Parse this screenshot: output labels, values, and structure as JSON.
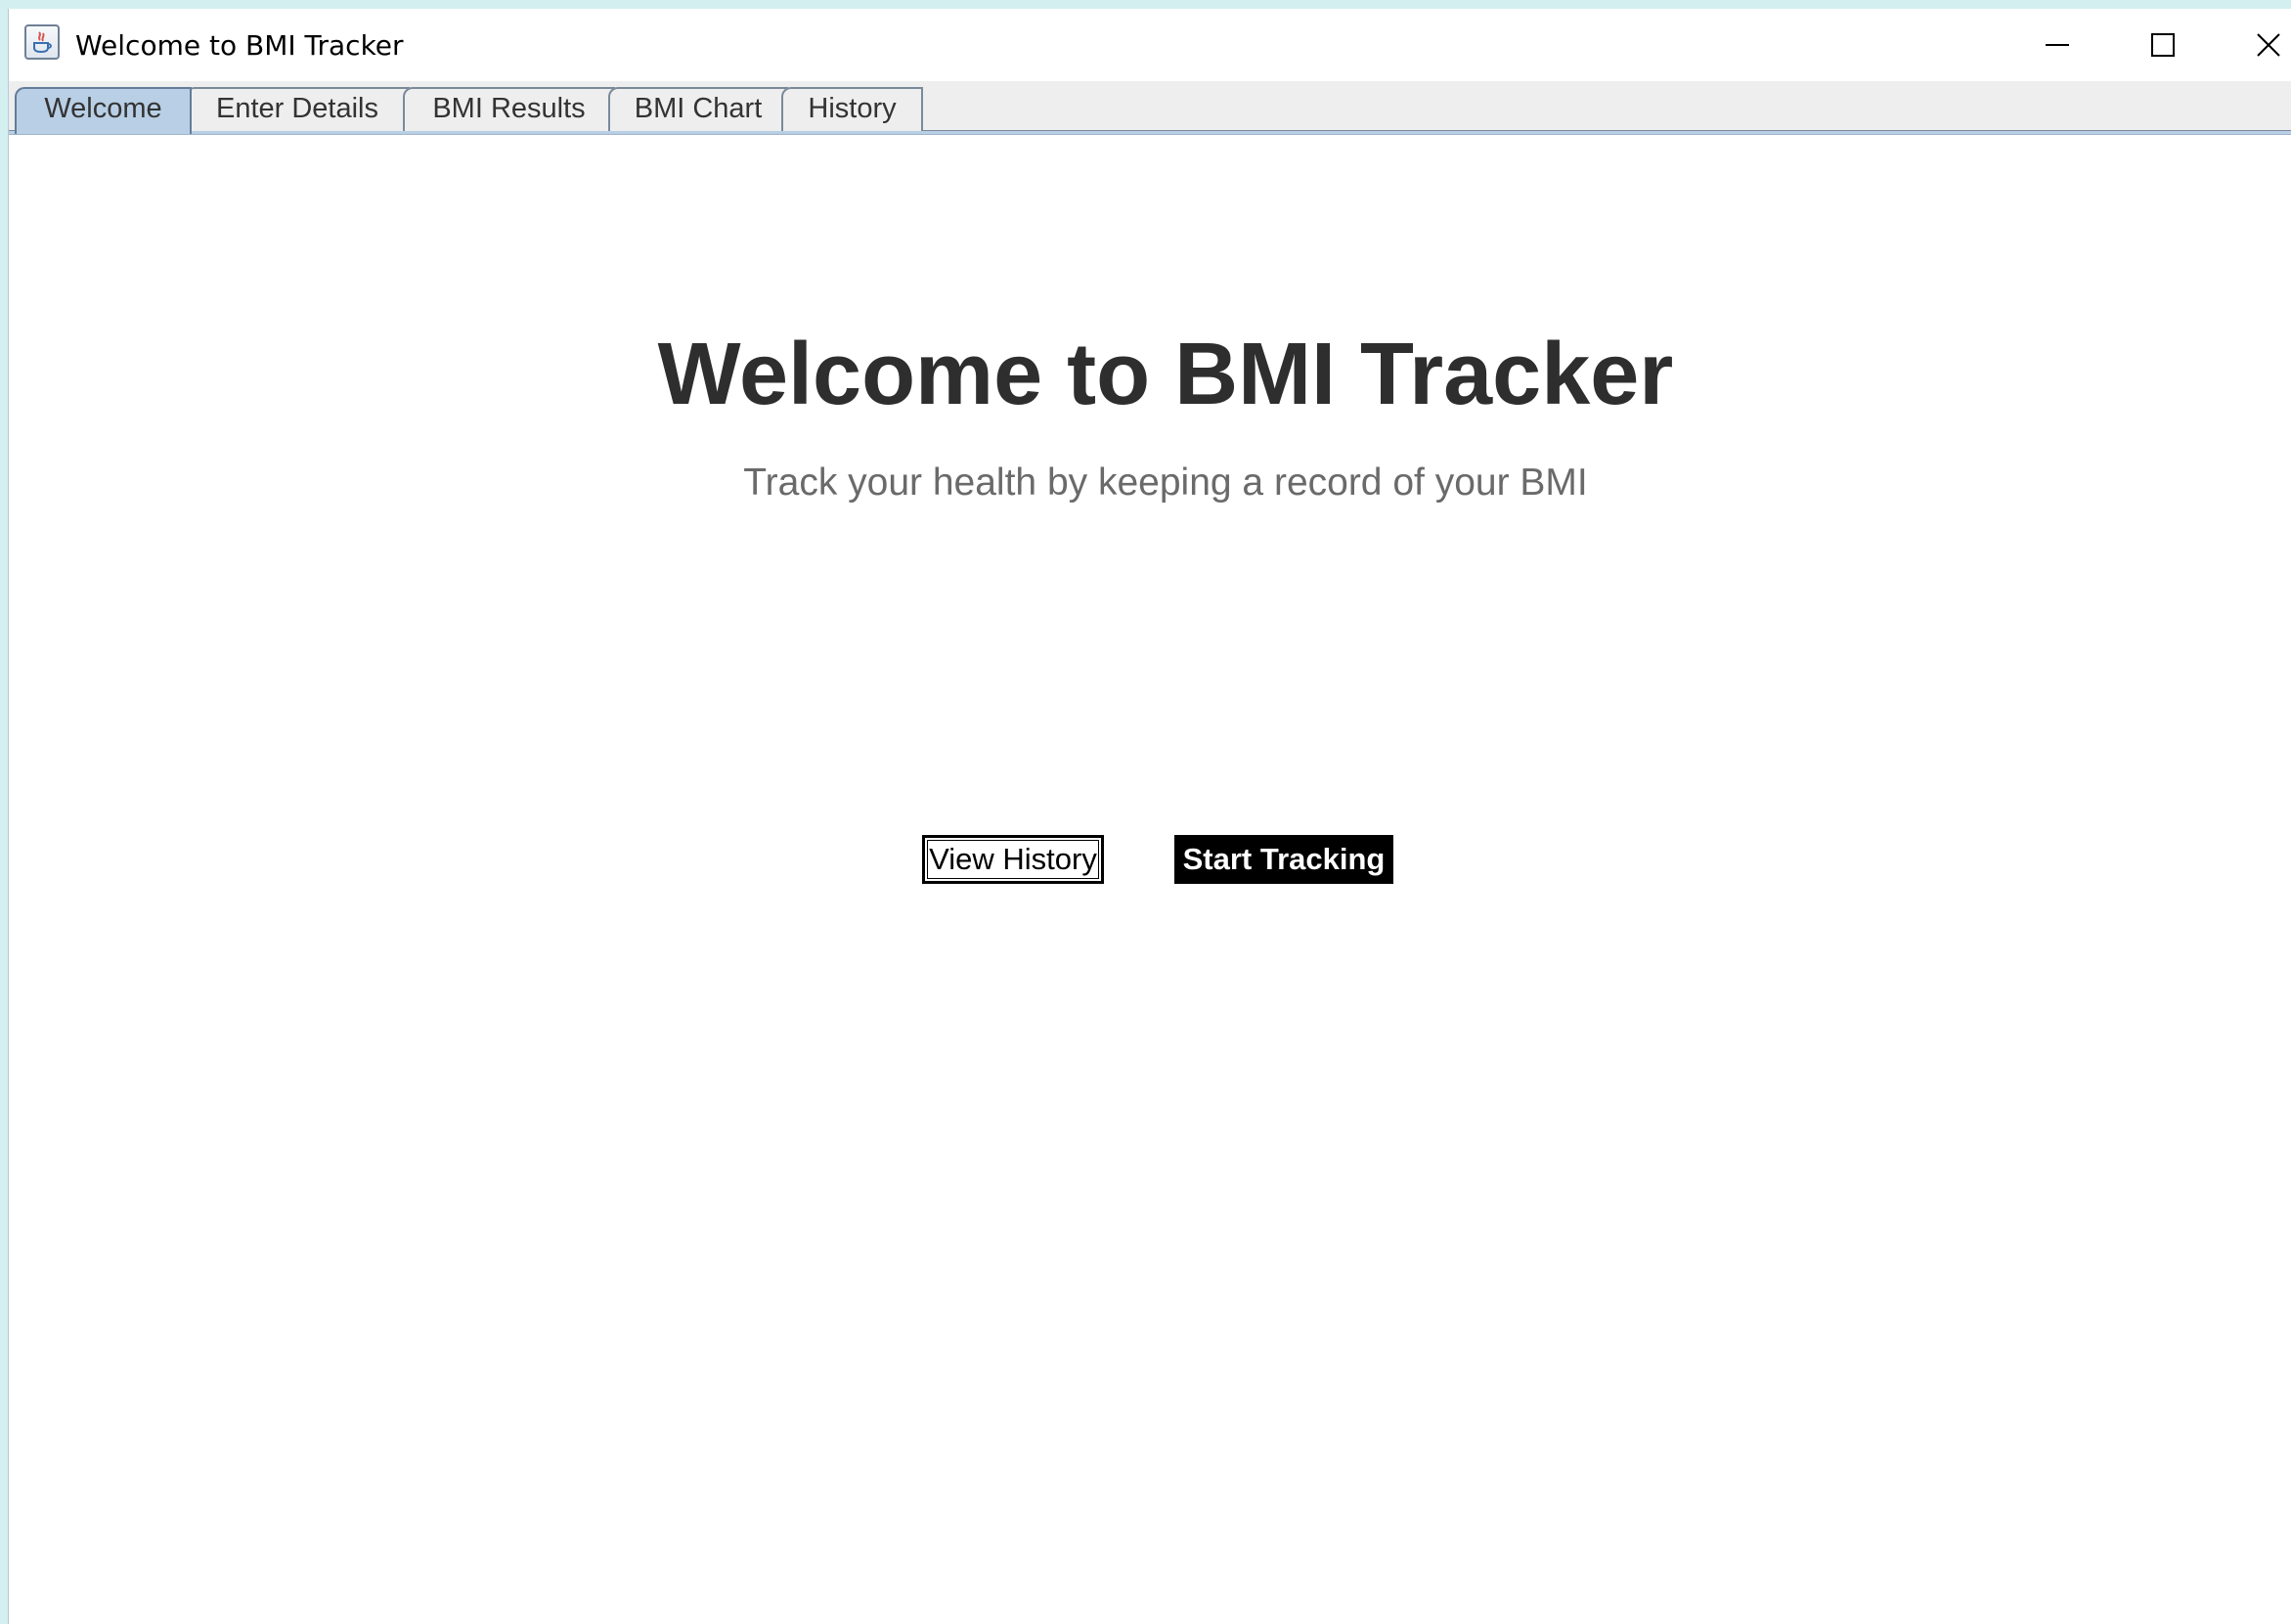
{
  "window": {
    "title": "Welcome to BMI Tracker",
    "controls": {
      "minimize": "minimize-icon",
      "maximize": "maximize-icon",
      "close": "close-icon"
    }
  },
  "tabs": [
    {
      "label": "Welcome",
      "selected": true
    },
    {
      "label": "Enter Details",
      "selected": false
    },
    {
      "label": "BMI Results",
      "selected": false
    },
    {
      "label": "BMI Chart",
      "selected": false
    },
    {
      "label": "History",
      "selected": false
    }
  ],
  "welcome": {
    "heading": "Welcome to BMI Tracker",
    "subheading": "Track your health by keeping a record of your BMI",
    "view_history_label": "View History",
    "start_tracking_label": "Start Tracking"
  },
  "colors": {
    "selected_tab": "#b8cfe5",
    "tab_background": "#eeeeee",
    "primary_button": "#000000",
    "heading_text": "#2e2e2e",
    "subheading_text": "#6a6a6a"
  }
}
